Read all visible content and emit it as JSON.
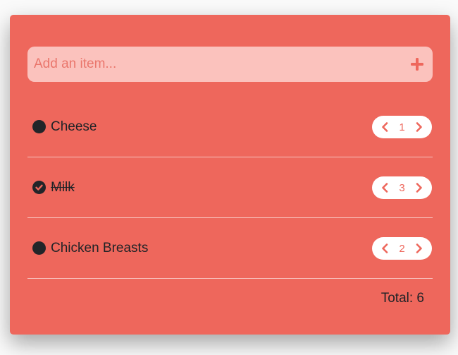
{
  "add_bar": {
    "placeholder": "Add an item...",
    "add_icon": "plus-icon"
  },
  "items": [
    {
      "label": "Cheese",
      "completed": false,
      "quantity": "1"
    },
    {
      "label": "Milk",
      "completed": true,
      "quantity": "3"
    },
    {
      "label": "Chicken Breasts",
      "completed": false,
      "quantity": "2"
    }
  ],
  "icons": {
    "decrease": "chevron-left-icon",
    "increase": "chevron-right-icon",
    "checked": "checkmark-icon"
  },
  "total": {
    "label": "Total: 6"
  },
  "colors": {
    "card": "#ee675c",
    "input_bg": "#fbc2bd",
    "text": "#1f2327",
    "accent": "#ee675c"
  }
}
